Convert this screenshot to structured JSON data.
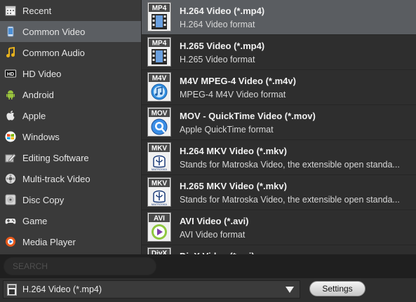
{
  "sidebar": {
    "items": [
      {
        "label": "Recent",
        "icon": "calendar-icon",
        "selected": false
      },
      {
        "label": "Common Video",
        "icon": "phone-icon",
        "selected": true
      },
      {
        "label": "Common Audio",
        "icon": "music-note-icon",
        "selected": false
      },
      {
        "label": "HD Video",
        "icon": "hd-icon",
        "selected": false
      },
      {
        "label": "Android",
        "icon": "android-icon",
        "selected": false
      },
      {
        "label": "Apple",
        "icon": "apple-icon",
        "selected": false
      },
      {
        "label": "Windows",
        "icon": "windows-icon",
        "selected": false
      },
      {
        "label": "Editing Software",
        "icon": "edit-icon",
        "selected": false
      },
      {
        "label": "Multi-track Video",
        "icon": "multitrack-icon",
        "selected": false
      },
      {
        "label": "Disc Copy",
        "icon": "disc-icon",
        "selected": false
      },
      {
        "label": "Game",
        "icon": "gamepad-icon",
        "selected": false
      },
      {
        "label": "Media Player",
        "icon": "media-player-icon",
        "selected": false
      }
    ]
  },
  "formats": {
    "items": [
      {
        "badge": "MP4",
        "title": "H.264 Video (*.mp4)",
        "desc": "H.264 Video format",
        "icon": "film-icon",
        "selected": true
      },
      {
        "badge": "MP4",
        "title": "H.265 Video (*.mp4)",
        "desc": "H.265 Video format",
        "icon": "film-icon",
        "selected": false
      },
      {
        "badge": "M4V",
        "title": "M4V MPEG-4 Video (*.m4v)",
        "desc": "MPEG-4 M4V Video format",
        "icon": "itunes-icon",
        "selected": false
      },
      {
        "badge": "MOV",
        "title": "MOV - QuickTime Video (*.mov)",
        "desc": "Apple QuickTime format",
        "icon": "quicktime-icon",
        "selected": false
      },
      {
        "badge": "MKV",
        "title": "H.264 MKV Video (*.mkv)",
        "desc": "Stands for Matroska Video, the extensible open standa...",
        "icon": "matroska-icon",
        "selected": false
      },
      {
        "badge": "MKV",
        "title": "H.265 MKV Video (*.mkv)",
        "desc": "Stands for Matroska Video, the extensible open standa...",
        "icon": "matroska-icon",
        "selected": false
      },
      {
        "badge": "AVI",
        "title": "AVI Video (*.avi)",
        "desc": "AVI Video format",
        "icon": "play-disc-icon",
        "selected": false
      },
      {
        "badge": "DivX",
        "title": "DivX Video (*.avi)",
        "desc": "",
        "icon": "divx-icon",
        "selected": false
      }
    ]
  },
  "search": {
    "placeholder": "SEARCH",
    "value": ""
  },
  "profile": {
    "selected": "H.264 Video (*.mp4)"
  },
  "settings_label": "Settings",
  "colors": {
    "selected_bg": "#5b5e62",
    "panel_bg": "#2e2e2e",
    "sidebar_bg": "#3a3a3a"
  }
}
